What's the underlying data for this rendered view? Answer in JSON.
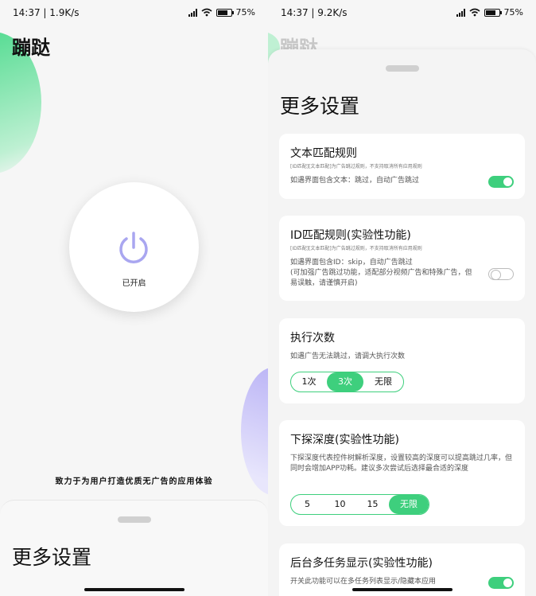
{
  "status_left": {
    "time": "14:37",
    "speed": "1.9K/s",
    "battery": "75"
  },
  "status_right": {
    "time": "14:37",
    "speed": "9.2K/s",
    "battery": "75"
  },
  "app": {
    "title": "蹦跶",
    "power_label": "已开启",
    "slogan": "致力于为用户打造优质无广告的应用体验",
    "sheet_title": "更多设置"
  },
  "settings": {
    "title": "更多设置",
    "text_rule": {
      "title": "文本匹配规则",
      "note": "[ID匹配][文本匹配]为广告跳过规则，不支持取消所有应用规则",
      "desc": "如遇界面包含文本：跳过，自动广告跳过",
      "enabled": true
    },
    "id_rule": {
      "title": "ID匹配规则(实验性功能)",
      "note": "[ID匹配][文本匹配]为广告跳过规则，不支持取消所有应用规则",
      "desc1": "如遇界面包含ID：skip，自动广告跳过",
      "desc2": "(可加强广告跳过功能，适配部分视频广告和特殊广告，但易误触，请谨慎开启)",
      "enabled": false
    },
    "exec_count": {
      "title": "执行次数",
      "desc": "如遇广告无法跳过，请调大执行次数",
      "options": [
        "1次",
        "3次",
        "无限"
      ],
      "selected": "3次"
    },
    "depth": {
      "title": "下探深度(实验性功能)",
      "desc": "下探深度代表控件树解析深度，设置较高的深度可以提高跳过几率，但同时会增加APP功耗。建议多次尝试后选择最合适的深度",
      "options": [
        "5",
        "10",
        "15",
        "无限"
      ],
      "selected": "无限"
    },
    "multitask": {
      "title": "后台多任务显示(实验性功能)",
      "desc": "开关此功能可以在多任务列表显示/隐藏本应用",
      "enabled": true
    }
  },
  "colors": {
    "accent": "#3ecf7d",
    "power_icon": "#a9a6f0"
  }
}
